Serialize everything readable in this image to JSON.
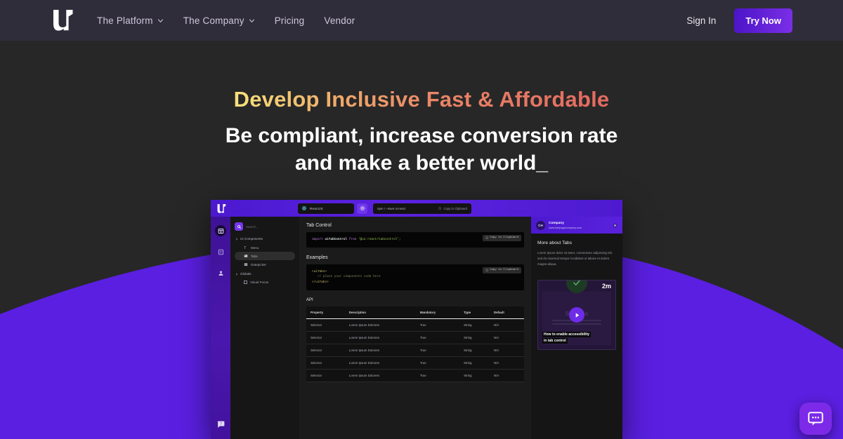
{
  "navbar": {
    "logo_name": "u",
    "links": [
      {
        "label": "The Platform",
        "has_caret": true
      },
      {
        "label": "The Company",
        "has_caret": true
      },
      {
        "label": "Pricing",
        "has_caret": false
      },
      {
        "label": "Vendor",
        "has_caret": false
      }
    ],
    "sign_in": "Sign In",
    "try_now": "Try Now",
    "bg": "#302D3A",
    "cta_gradient_from": "#4B14C8",
    "cta_gradient_to": "#7B2FE6"
  },
  "hero": {
    "title": "Develop Inclusive Fast & Affordable",
    "subtitle": "Be compliant, increase conversion rate and make a better world_",
    "title_gradient_from": "#F7E27C",
    "title_gradient_to": "#E36A60",
    "page_bg": "#272727",
    "wave_color": "#5A1FE0"
  },
  "mockup": {
    "topbar": {
      "framework": "ReactJS",
      "command": "npm i --save ui-react",
      "copy_label": "Copy to Clipboard"
    },
    "rail": {
      "icons": [
        "dashboard-icon",
        "docs-icon",
        "account-icon"
      ],
      "help": "help-icon"
    },
    "sidebar": {
      "search_placeholder": "Search...",
      "groups": [
        {
          "label": "UI Components",
          "items": [
            {
              "label": "Menu",
              "selected": false
            },
            {
              "label": "Tabs",
              "selected": true
            },
            {
              "label": "Datepicker",
              "selected": false
            }
          ]
        },
        {
          "label": "Globals",
          "items": [
            {
              "label": "Visual Focus",
              "selected": false,
              "checkbox": true
            }
          ]
        }
      ]
    },
    "content": {
      "title": "Tab Control",
      "import_code": {
        "kw1": "import",
        "id": "uiTabControl",
        "kw2": "from",
        "str": "'@ui-react/tabcontrol';"
      },
      "examples_title": "Examples",
      "example_code": {
        "open_tag": "<uiTabs>",
        "comment": "// place your components code here",
        "close_tag": "</uiTabs>"
      },
      "copy_label": "Copy to Clipboard",
      "api_title": "API",
      "api_table": {
        "columns": [
          "Property",
          "Description",
          "Mandatory",
          "Type",
          "Default"
        ],
        "rows": [
          [
            "Selector",
            "Lorem Ipsum Dolorem",
            "True",
            "String",
            "N/A"
          ],
          [
            "Selector",
            "Lorem Ipsum Dolorem",
            "True",
            "String",
            "N/A"
          ],
          [
            "Selector",
            "Lorem Ipsum Dolorem",
            "True",
            "String",
            "N/A"
          ],
          [
            "Selector",
            "Lorem Ipsum Dolorem",
            "True",
            "String",
            "N/A"
          ],
          [
            "Selector",
            "Lorem Ipsum Dolorem",
            "True",
            "String",
            "N/A"
          ]
        ]
      }
    },
    "panel": {
      "avatar_initials": "CH",
      "company": "Company",
      "url": "www.hubpagecompany.com",
      "heading": "More about Tabs",
      "paragraph": "Lorem ipsum dolor sit amet, consectetur adipiscing elit, sed do eiusmod tempor incididunt ut labore et dolore magna aliqua.",
      "video": {
        "duration": "2m",
        "overlay_title": "Success",
        "caption_line1": "How to enable accessibility",
        "caption_line2": "in tab control"
      }
    }
  },
  "chat_widget": {
    "name": "chat-bubble",
    "color": "#7C2AE8"
  }
}
